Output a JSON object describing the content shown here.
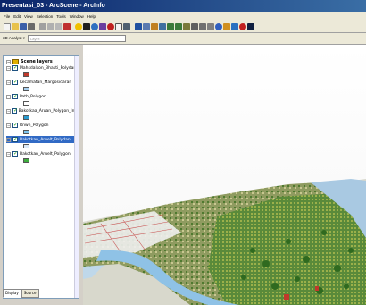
{
  "window": {
    "title": "Presentasi_03 - ArcScene - ArcInfo"
  },
  "menu": [
    "File",
    "Edit",
    "View",
    "Selection",
    "Tools",
    "Window",
    "Help"
  ],
  "toolbar2": {
    "analyst_label": "3D Analyst ▾",
    "layer_placeholder": "Layer:"
  },
  "toc": {
    "root": "Scene layers",
    "layers": [
      {
        "label": "Mahsdalkon_Bhakti_Polydan",
        "swatch": "#c0392b",
        "selected": false
      },
      {
        "label": "Kecamatan_Margosidaran",
        "swatch": "#a8d0f0",
        "selected": false
      },
      {
        "label": "Path_Polygon",
        "swatch": "#ffffff",
        "selected": false
      },
      {
        "label": "Bakotkaa_Aruan_Polygon_Into",
        "swatch": "#2a9bd0",
        "selected": false
      },
      {
        "label": "Rnwn_Polygon",
        "swatch": "#7fc6ef",
        "selected": false
      },
      {
        "label": "Bakotkan_Aruelt_Polydan",
        "swatch": "#dbe9f8",
        "selected": true
      },
      {
        "label": "Bakotkan_Aruelt_Polygon",
        "swatch": "#3fae3f",
        "selected": false
      }
    ],
    "tabs": [
      "Display",
      "Source"
    ]
  }
}
